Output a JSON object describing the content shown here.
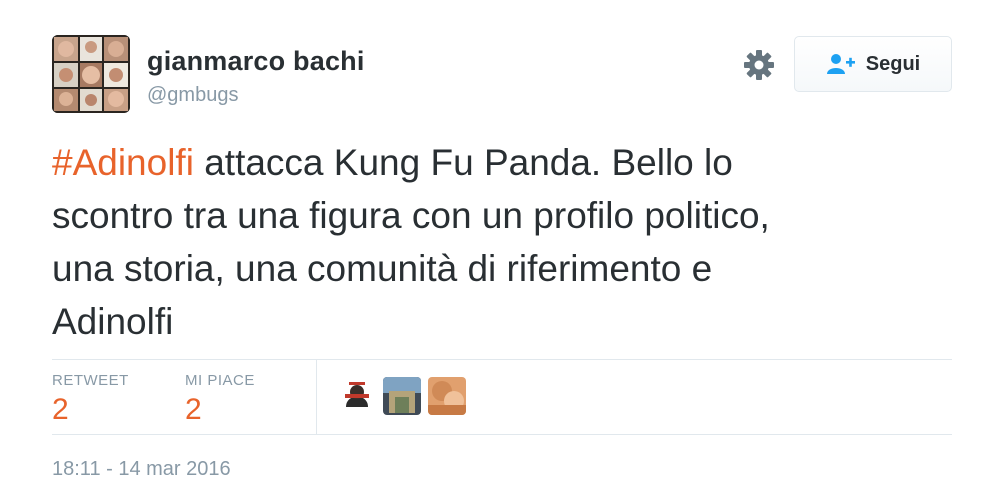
{
  "tweet": {
    "user": {
      "display_name": "gianmarco bachi",
      "handle": "@gmbugs",
      "avatar": "user-avatar"
    },
    "follow_button": {
      "label": "Segui",
      "icon": "add-user-icon"
    },
    "settings_icon": "gear-icon",
    "text_parts": {
      "hashtag": "#Adinolfi",
      "line1": " attacca Kung Fu Panda. Bello lo",
      "line2": "scontro tra una figura con un profilo politico,",
      "line3": "una storia, una comunità di riferimento e",
      "line4": "Adinolfi"
    },
    "stats": {
      "retweet_label": "RETWEET",
      "retweet_count": "2",
      "like_label": "MI PIACE",
      "like_count": "2"
    },
    "likers": [
      "liker-avatar-1",
      "liker-avatar-2",
      "liker-avatar-3"
    ],
    "timestamp": "18:11 - 14 mar 2016"
  },
  "colors": {
    "accent": "#e8632b",
    "text": "#292f33",
    "muted": "#8899a6",
    "border": "#e1e8ed"
  }
}
